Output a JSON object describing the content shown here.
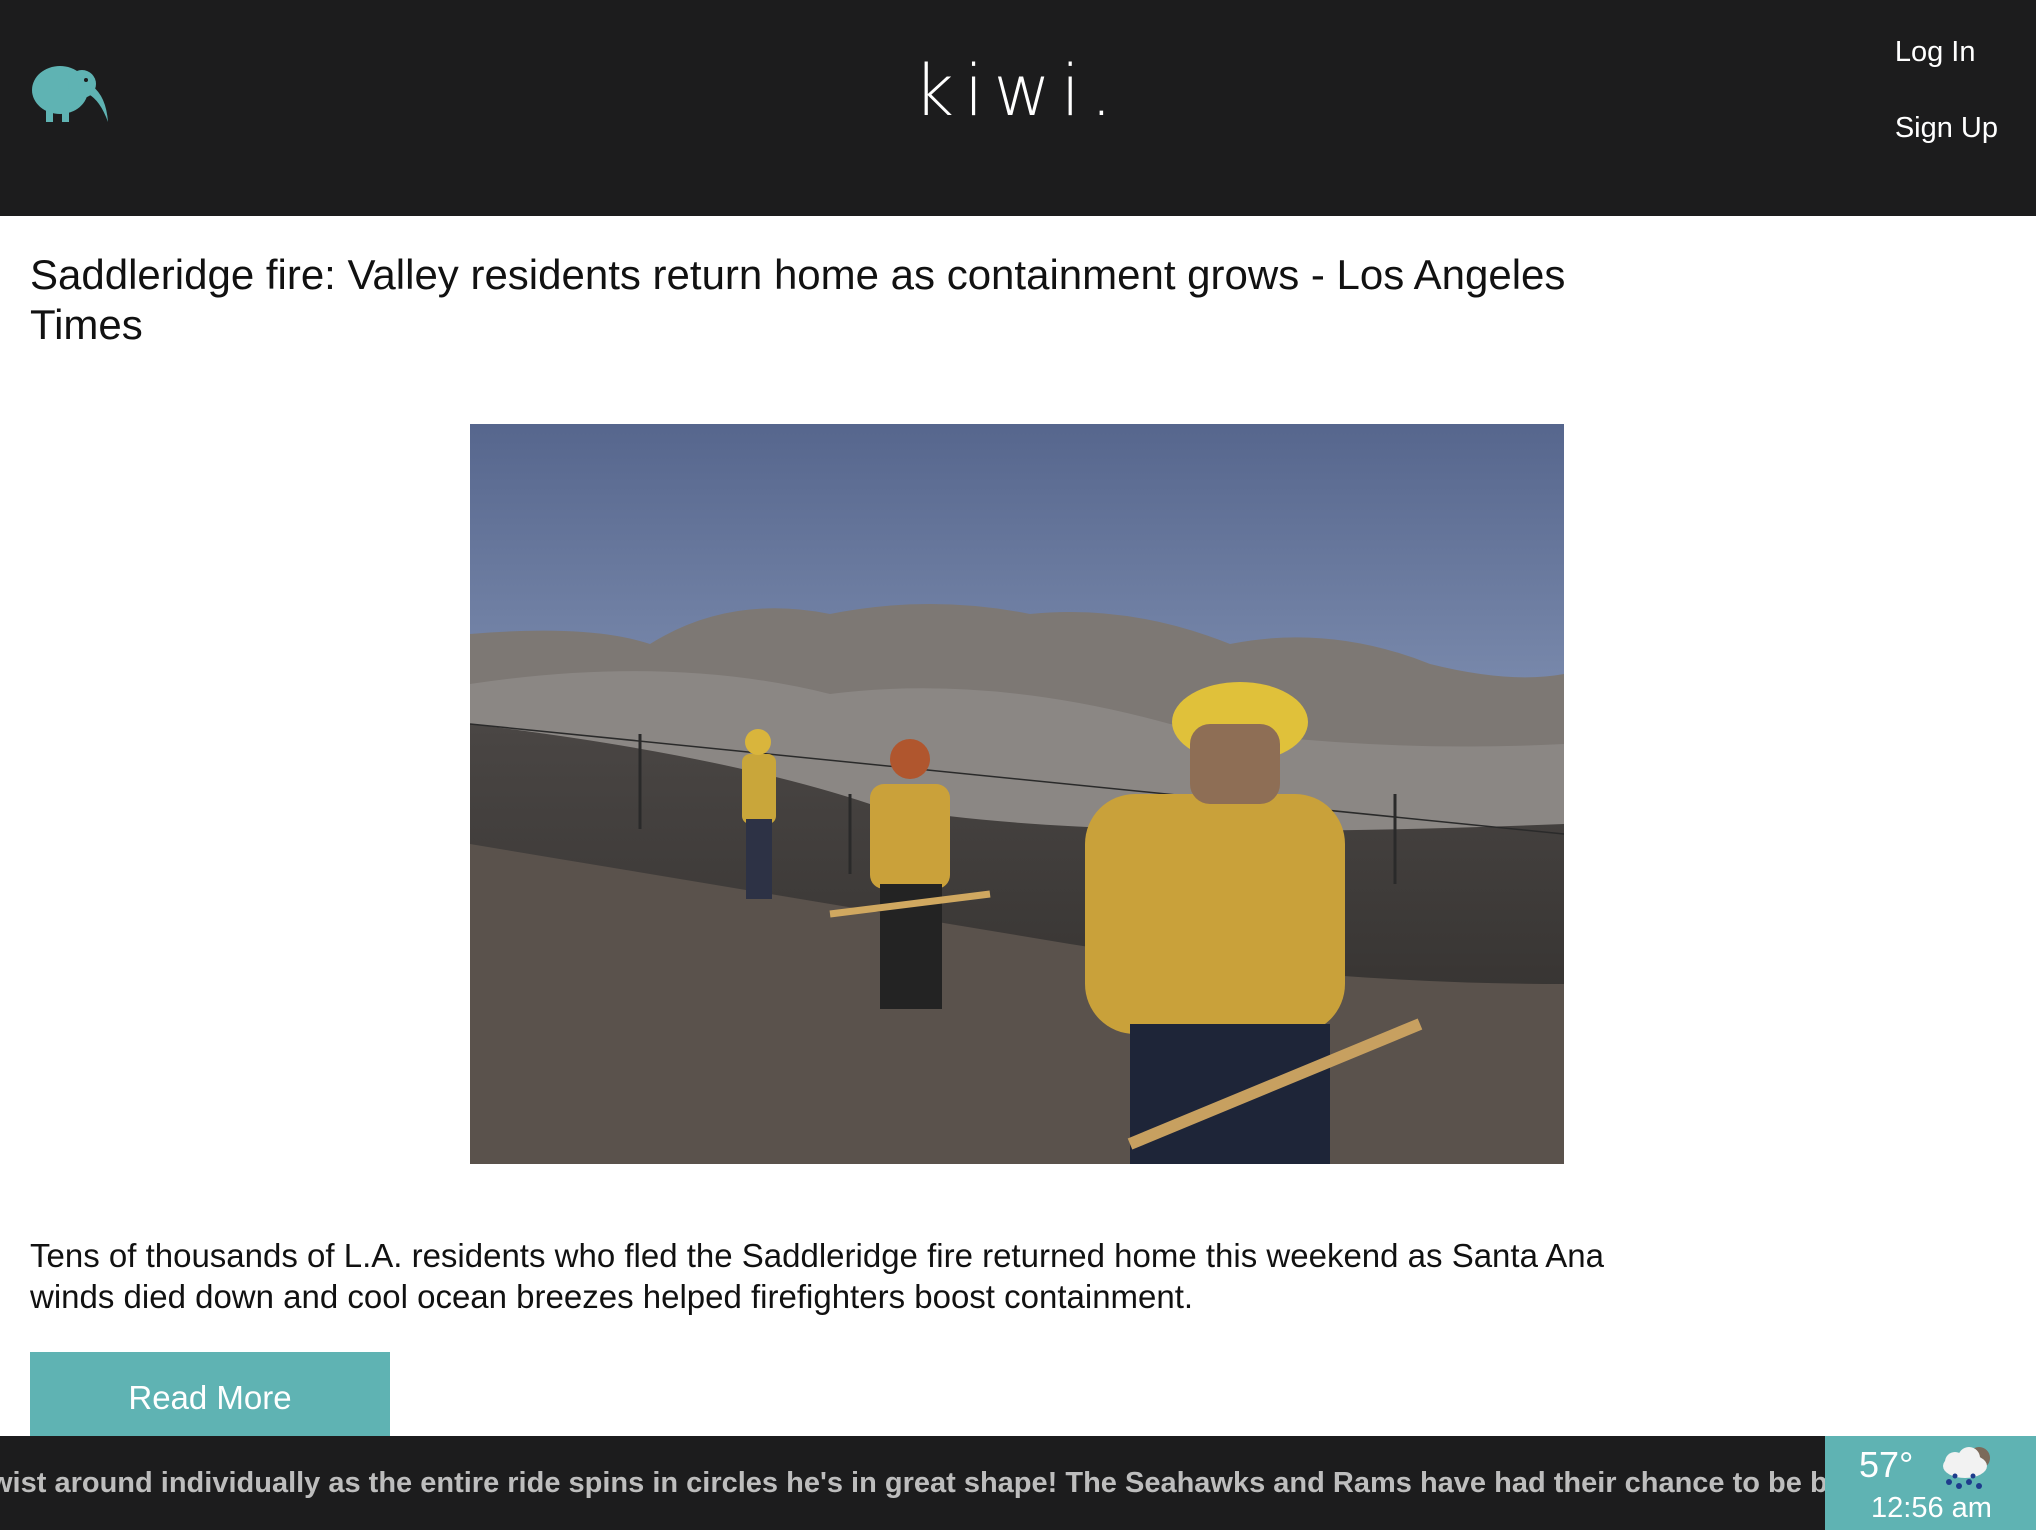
{
  "header": {
    "brand": "kiwi.",
    "logo_icon": "kiwi-bird-icon",
    "login_label": "Log In",
    "signup_label": "Sign Up",
    "background": "#1c1c1d"
  },
  "article": {
    "title": "Saddleridge fire: Valley residents return home as containment grows - Los Angeles Times",
    "image_alt": "Firefighters walking on burned hillside",
    "summary": "Tens of thousands of L.A. residents who fled the Saddleridge fire returned home this weekend as Santa Ana winds died down and cool ocean breezes helped firefighters boost containment.",
    "read_more_label": "Read More"
  },
  "ticker": {
    "text": "wist around individually as the entire ride spins in circles he's in great shape! The Seahawks and Rams have had their chance to be bullies in the c"
  },
  "weather": {
    "temperature": "57°",
    "time": "12:56 am",
    "icon": "rain-cloud-icon"
  },
  "colors": {
    "accent": "#5fb3b3",
    "dark": "#1c1c1d"
  }
}
